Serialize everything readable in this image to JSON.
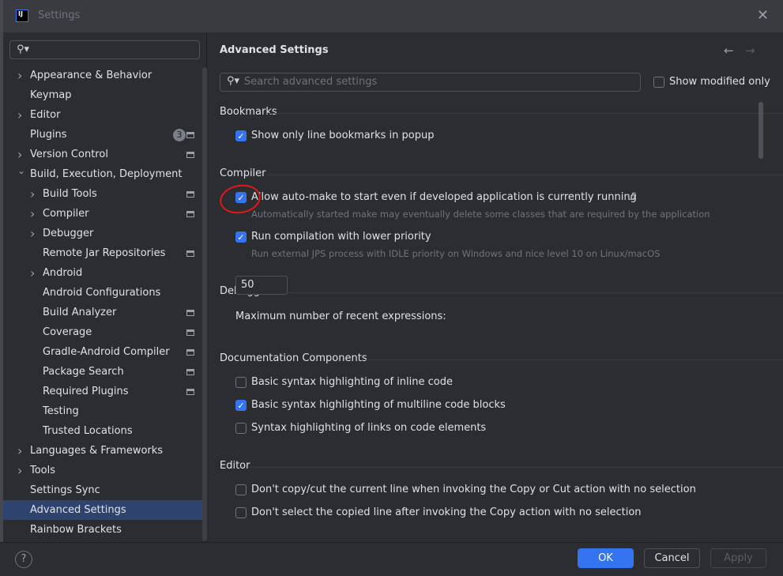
{
  "window": {
    "title": "Settings",
    "logo": "IJ"
  },
  "sidebar": {
    "search_value": "",
    "items": [
      {
        "label": "Appearance & Behavior",
        "level": 0,
        "chevron": "right"
      },
      {
        "label": "Keymap",
        "level": 0
      },
      {
        "label": "Editor",
        "level": 0,
        "chevron": "right"
      },
      {
        "label": "Plugins",
        "level": 0,
        "badge": "3",
        "project": true
      },
      {
        "label": "Version Control",
        "level": 0,
        "chevron": "right",
        "project": true
      },
      {
        "label": "Build, Execution, Deployment",
        "level": 0,
        "chevron": "down"
      },
      {
        "label": "Build Tools",
        "level": 1,
        "chevron": "right",
        "project": true
      },
      {
        "label": "Compiler",
        "level": 1,
        "chevron": "right",
        "project": true
      },
      {
        "label": "Debugger",
        "level": 1,
        "chevron": "right"
      },
      {
        "label": "Remote Jar Repositories",
        "level": 1,
        "project": true
      },
      {
        "label": "Android",
        "level": 1,
        "chevron": "right"
      },
      {
        "label": "Android Configurations",
        "level": 1
      },
      {
        "label": "Build Analyzer",
        "level": 1,
        "project": true
      },
      {
        "label": "Coverage",
        "level": 1,
        "project": true
      },
      {
        "label": "Gradle-Android Compiler",
        "level": 1,
        "project": true
      },
      {
        "label": "Package Search",
        "level": 1,
        "project": true
      },
      {
        "label": "Required Plugins",
        "level": 1,
        "project": true
      },
      {
        "label": "Testing",
        "level": 1
      },
      {
        "label": "Trusted Locations",
        "level": 1
      },
      {
        "label": "Languages & Frameworks",
        "level": 0,
        "chevron": "right"
      },
      {
        "label": "Tools",
        "level": 0,
        "chevron": "right"
      },
      {
        "label": "Settings Sync",
        "level": 0
      },
      {
        "label": "Advanced Settings",
        "level": 0,
        "selected": true
      },
      {
        "label": "Rainbow Brackets",
        "level": 0
      }
    ]
  },
  "main": {
    "title": "Advanced Settings",
    "search_placeholder": "Search advanced settings",
    "show_modified_label": "Show modified only",
    "sections": {
      "bookmarks": "Bookmarks",
      "compiler": "Compiler",
      "debugger": "Debugger",
      "documentation": "Documentation Components",
      "editor": "Editor"
    },
    "options": {
      "bookmarks_popup": "Show only line bookmarks in popup",
      "auto_make": "Allow auto-make to start even if developed application is currently running",
      "auto_make_hint": "Automatically started make may eventually delete some classes that are required by the application",
      "lower_priority": "Run compilation with lower priority",
      "lower_priority_hint": "Run external JPS process with IDLE priority on Windows and nice level 10 on Linux/macOS",
      "recent_expr_label": "Maximum number of recent expressions:",
      "recent_expr_value": "50",
      "inline_code": "Basic syntax highlighting of inline code",
      "multiline_code": "Basic syntax highlighting of multiline code blocks",
      "links_code": "Syntax highlighting of links on code elements",
      "no_copy_line": "Don't copy/cut the current line when invoking the Copy or Cut action with no selection",
      "no_select_copied": "Don't select the copied line after invoking the Copy action with no selection"
    }
  },
  "footer": {
    "help": "?",
    "ok": "OK",
    "cancel": "Cancel",
    "apply": "Apply"
  },
  "colors": {
    "accent": "#3574f0",
    "selection": "#2e436e",
    "annotation": "#e0181e"
  }
}
